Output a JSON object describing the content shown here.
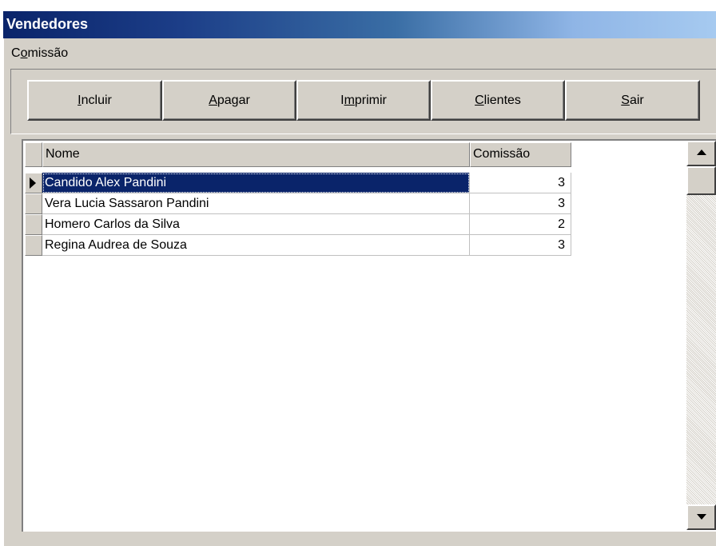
{
  "window": {
    "title": "Vendedores"
  },
  "menu": {
    "comissao": {
      "prefix": "C",
      "accel": "o",
      "rest": "missão"
    }
  },
  "toolbar": {
    "incluir": {
      "accel": "I",
      "rest": "ncluir"
    },
    "apagar": {
      "accel": "A",
      "rest": "pagar"
    },
    "imprimir": {
      "prefix": "I",
      "accel": "m",
      "rest": "primir"
    },
    "clientes": {
      "accel": "C",
      "rest": "lientes"
    },
    "sair": {
      "accel": "S",
      "rest": "air"
    }
  },
  "grid": {
    "columns": {
      "nome": "Nome",
      "comissao": "Comissão"
    },
    "rows": [
      {
        "nome": "Candido Alex Pandini",
        "comissao": "3"
      },
      {
        "nome": "Vera Lucia Sassaron Pandini",
        "comissao": "3"
      },
      {
        "nome": "Homero Carlos da Silva",
        "comissao": "2"
      },
      {
        "nome": "Regina Audrea de Souza",
        "comissao": "3"
      }
    ],
    "selected_row": 0
  },
  "colors": {
    "titlebar_start": "#0a246a",
    "titlebar_end": "#a6caf0",
    "face": "#d4d0c8",
    "selection": "#0a246a"
  },
  "icons": {
    "row_indicator": "triangle-right-icon",
    "scroll_up": "triangle-up-icon",
    "scroll_down": "triangle-down-icon"
  }
}
